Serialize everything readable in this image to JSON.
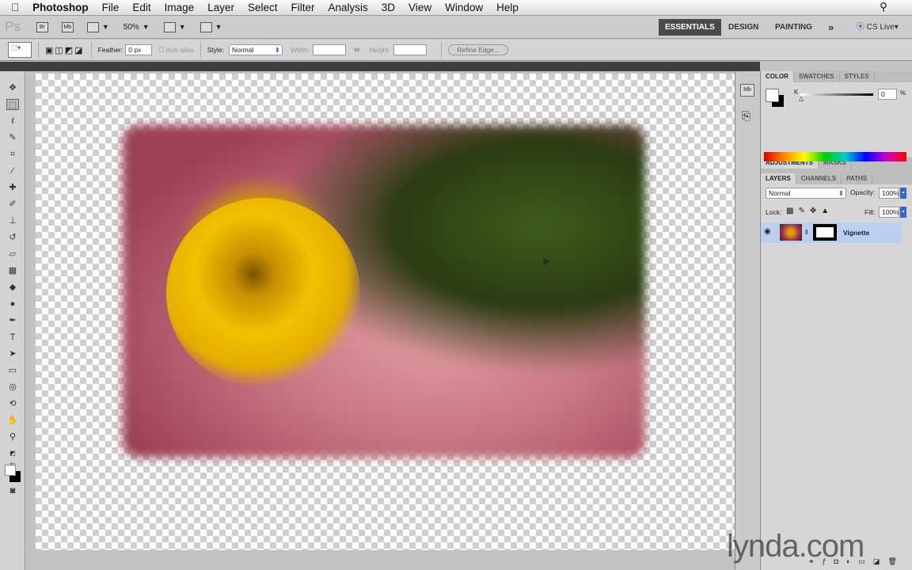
{
  "menubar": {
    "app": "Photoshop",
    "items": [
      "File",
      "Edit",
      "Image",
      "Layer",
      "Select",
      "Filter",
      "Analysis",
      "3D",
      "View",
      "Window",
      "Help"
    ]
  },
  "appbar": {
    "logo": "Ps",
    "bridge": "Br",
    "mini_bridge": "Mb",
    "zoom": "50%",
    "workspaces": [
      "ESSENTIALS",
      "DESIGN",
      "PAINTING"
    ],
    "more": "»",
    "cs_live": "CS Live"
  },
  "options": {
    "feather_label": "Feather:",
    "feather_value": "0 px",
    "anti_alias": "Anti-alias",
    "style_label": "Style:",
    "style_value": "Normal",
    "width_label": "Width:",
    "height_label": "Height:",
    "refine_edge": "Refine Edge..."
  },
  "color_panel": {
    "tabs": [
      "COLOR",
      "SWATCHES",
      "STYLES"
    ],
    "channel": "K",
    "value": "0",
    "unit": "%"
  },
  "adjust_panel": {
    "tabs": [
      "ADJUSTMENTS",
      "MASKS"
    ]
  },
  "layers_panel": {
    "tabs": [
      "LAYERS",
      "CHANNELS",
      "PATHS"
    ],
    "blend_mode": "Normal",
    "opacity_label": "Opacity:",
    "opacity": "100%",
    "lock_label": "Lock:",
    "fill_label": "Fill:",
    "fill": "100%",
    "layers": [
      {
        "name": "Vignette"
      }
    ]
  },
  "watermark": "lynda.com"
}
